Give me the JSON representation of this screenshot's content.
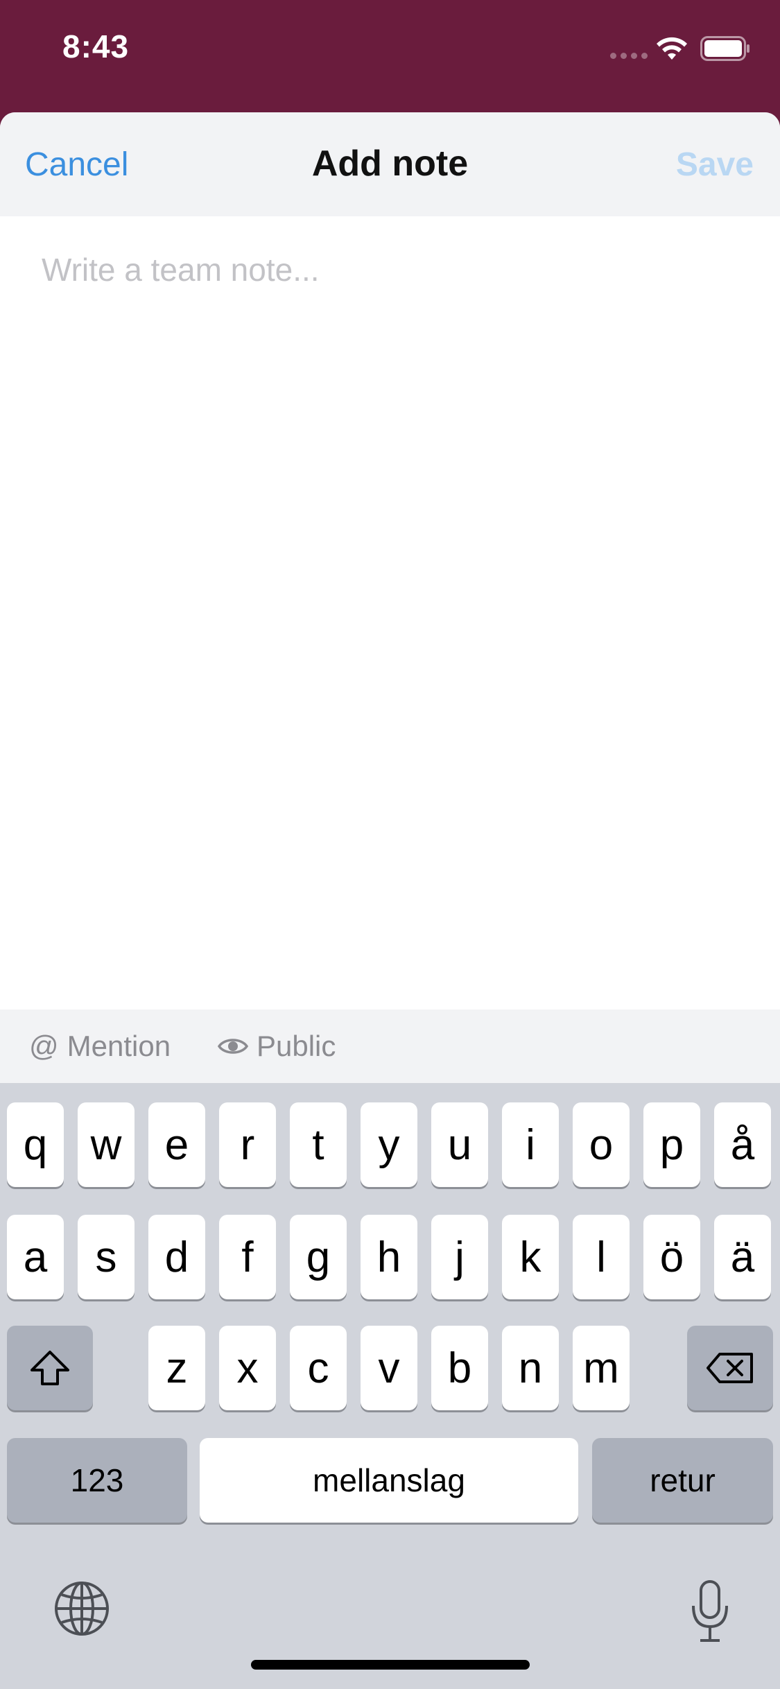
{
  "status_bar": {
    "time": "8:43"
  },
  "nav": {
    "cancel_label": "Cancel",
    "title": "Add note",
    "save_label": "Save"
  },
  "note": {
    "placeholder": "Write a team note...",
    "value": ""
  },
  "accessory": {
    "mention": {
      "symbol": "@",
      "label": "Mention"
    },
    "public": {
      "label": "Public"
    }
  },
  "keyboard": {
    "row1": [
      "q",
      "w",
      "e",
      "r",
      "t",
      "y",
      "u",
      "i",
      "o",
      "p",
      "å"
    ],
    "row2": [
      "a",
      "s",
      "d",
      "f",
      "g",
      "h",
      "j",
      "k",
      "l",
      "ö",
      "ä"
    ],
    "row3": [
      "z",
      "x",
      "c",
      "v",
      "b",
      "n",
      "m"
    ],
    "numbers_label": "123",
    "space_label": "mellanslag",
    "return_label": "retur"
  },
  "colors": {
    "status_bar": "#6a1c3d",
    "link": "#3b8fdf",
    "save_disabled": "#b9d7f3",
    "keyboard_bg": "#d1d4db"
  }
}
